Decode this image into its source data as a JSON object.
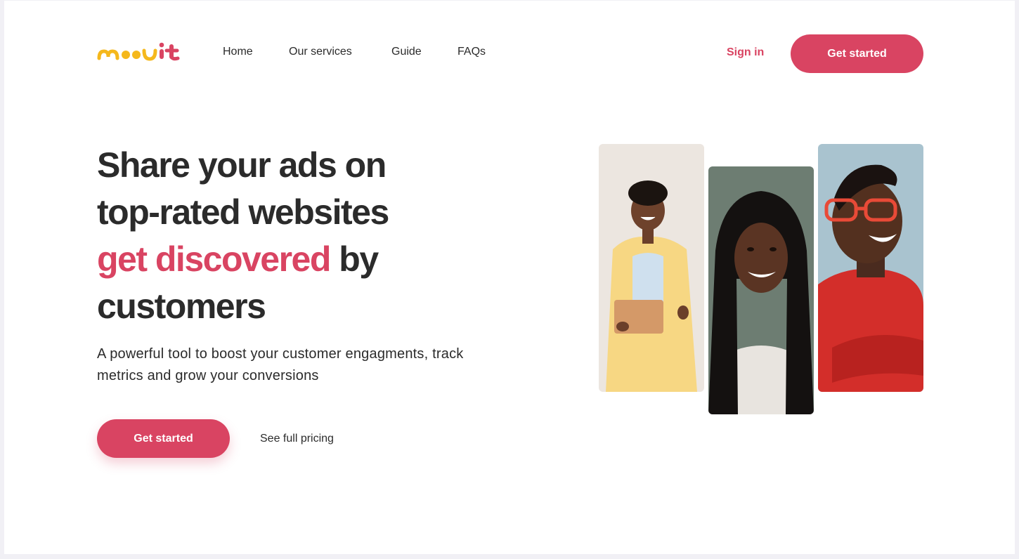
{
  "brand": {
    "logo_text": "moovit",
    "colors": {
      "accent": "#d94462",
      "logo_yellow": "#f5b81c",
      "text": "#2b2b2b"
    }
  },
  "nav": {
    "items": [
      {
        "label": "Home"
      },
      {
        "label": "Our services"
      },
      {
        "label": "Guide"
      },
      {
        "label": "FAQs"
      }
    ],
    "sign_in": "Sign in",
    "cta": "Get started"
  },
  "hero": {
    "headline_line1": "Share your ads on",
    "headline_line2": "top-rated websites",
    "headline_accent": "get discovered",
    "headline_after_accent": " by",
    "headline_line4": "customers",
    "subtitle": "A powerful tool to boost your customer engagments, track metrics and grow your conversions",
    "primary_cta": "Get started",
    "secondary_link": "See full pricing"
  },
  "photos": [
    {
      "icon": "woman-yellow-blazer-tablet-photo"
    },
    {
      "icon": "woman-braids-smiling-photo"
    },
    {
      "icon": "man-red-glasses-sweater-photo"
    }
  ]
}
